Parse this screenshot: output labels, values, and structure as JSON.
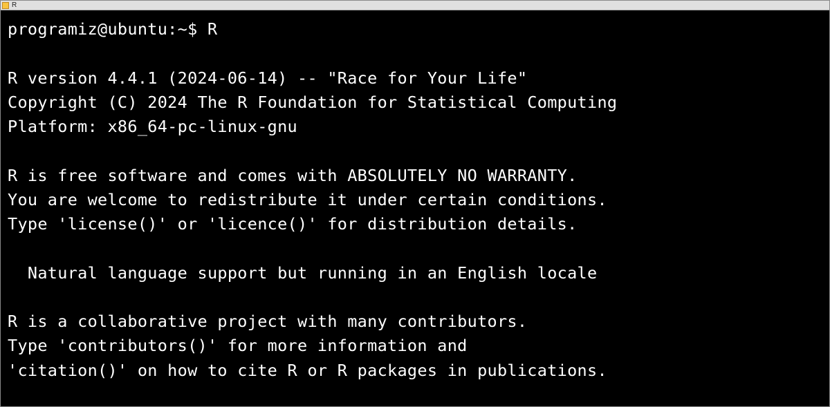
{
  "window": {
    "title": "R"
  },
  "terminal": {
    "prompt": "programiz@ubuntu:~$ ",
    "command": "R",
    "lines": [
      "",
      "R version 4.4.1 (2024-06-14) -- \"Race for Your Life\"",
      "Copyright (C) 2024 The R Foundation for Statistical Computing",
      "Platform: x86_64-pc-linux-gnu",
      "",
      "R is free software and comes with ABSOLUTELY NO WARRANTY.",
      "You are welcome to redistribute it under certain conditions.",
      "Type 'license()' or 'licence()' for distribution details.",
      "",
      "  Natural language support but running in an English locale",
      "",
      "R is a collaborative project with many contributors.",
      "Type 'contributors()' for more information and",
      "'citation()' on how to cite R or R packages in publications."
    ]
  }
}
